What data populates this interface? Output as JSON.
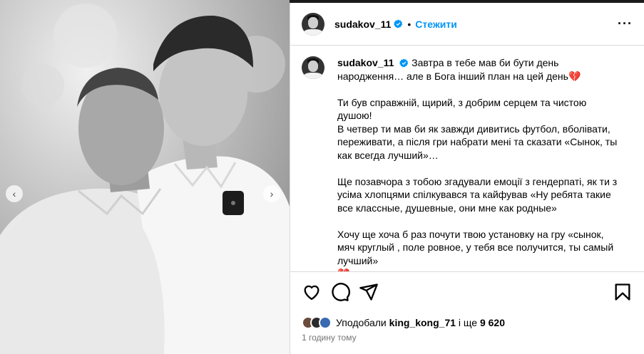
{
  "post": {
    "username": "sudakov_11",
    "follow_label": "Стежити",
    "dot": "•",
    "more_label": "···",
    "caption": {
      "line1": "Завтра в тебе мав би бути день народження… але в Бога інший план на цей день",
      "heart": "💔",
      "p2": "Ти був справжній, щирий, з добрим серцем та чистою душою!",
      "p3": "В четвер ти мав би як завжди дивитись футбол, вболівати, переживати, а після гри набрати мені та сказати «Сынок, ты как всегда лучший»…",
      "p4": "Ще позавчора з тобою згадували емоції з гендерпаті, як ти з усіма хлопцями спілкувався та кайфував «Ну ребята такие все классные, душевные, они мне как родные»",
      "p5": "Хочу ще хоча б раз почути твою установку на гру «сынок, мяч круглый , поле ровное, у тебя все получится, ты самый лучший»",
      "heart2": "💔"
    },
    "likes": {
      "prefix": "Уподобали",
      "user": "king_kong_71",
      "suffix": "і ще",
      "count": "9 620"
    },
    "time": "1 годину тому",
    "nav_prev": "‹",
    "nav_next": "›"
  },
  "icons": {
    "verified": "verified-icon",
    "like": "heart-icon",
    "comment": "comment-icon",
    "share": "share-icon",
    "save": "bookmark-icon",
    "more": "more-icon"
  },
  "colors": {
    "accent": "#0095f6",
    "verified": "#0095f6",
    "heart": "#8b1e2b"
  }
}
